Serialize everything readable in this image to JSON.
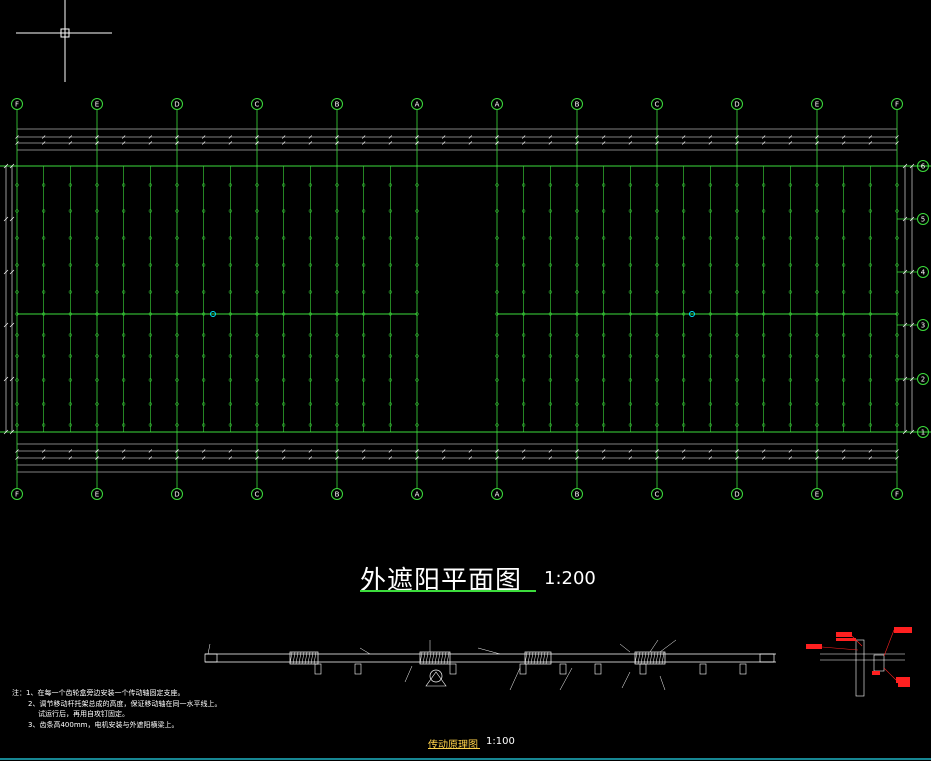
{
  "plan": {
    "title": "外遮阳平面图",
    "scale": "1:200",
    "column_labels": [
      "F",
      "E",
      "D",
      "C",
      "B",
      "A",
      "A",
      "B",
      "C",
      "D",
      "E",
      "F"
    ],
    "row_labels": [
      "1",
      "2",
      "3",
      "4",
      "5",
      "6"
    ]
  },
  "detail": {
    "title": "传动原理图",
    "scale": "1:100"
  },
  "notes": {
    "lines": [
      "注：1、在每一个齿轮盒旁边安装一个传动轴固定支座。",
      "2、调节移动杆托架总成的高度，保证移动轴在同一水平线上。",
      "试运行后，再用自攻钉固定。",
      "3、齿条高400mm，电机安装与外遮阳横梁上。"
    ]
  },
  "colors": {
    "background": "#000000",
    "grid_line": "#3cdc3c",
    "axis_bubble": "#3cdc3c",
    "axis_text": "#ffffff",
    "dimension_line": "#ffffff",
    "highlight": "#00e5ff",
    "callout": "#ff2020",
    "label_yellow": "#ffd24a"
  }
}
